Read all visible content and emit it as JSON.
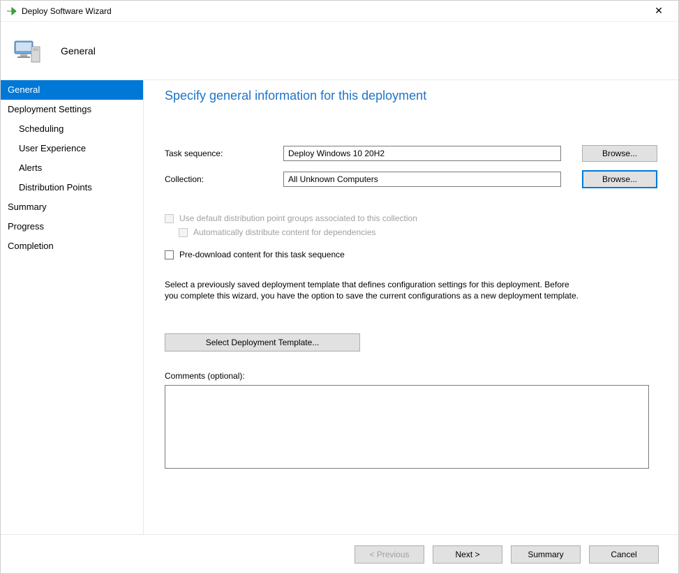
{
  "window": {
    "title": "Deploy Software Wizard",
    "close": "✕"
  },
  "header": {
    "page": "General"
  },
  "nav": {
    "items": [
      {
        "label": "General",
        "indent": 0,
        "selected": true
      },
      {
        "label": "Deployment Settings",
        "indent": 0,
        "selected": false
      },
      {
        "label": "Scheduling",
        "indent": 1,
        "selected": false
      },
      {
        "label": "User Experience",
        "indent": 1,
        "selected": false
      },
      {
        "label": "Alerts",
        "indent": 1,
        "selected": false
      },
      {
        "label": "Distribution Points",
        "indent": 1,
        "selected": false
      },
      {
        "label": "Summary",
        "indent": 0,
        "selected": false
      },
      {
        "label": "Progress",
        "indent": 0,
        "selected": false
      },
      {
        "label": "Completion",
        "indent": 0,
        "selected": false
      }
    ]
  },
  "main": {
    "heading": "Specify general information for this deployment",
    "task_label": "Task sequence:",
    "task_value": "Deploy Windows 10 20H2",
    "collection_label": "Collection:",
    "collection_value": "All Unknown Computers",
    "browse": "Browse...",
    "chk_default_dp": "Use default distribution point groups associated to this collection",
    "chk_auto_dist": "Automatically distribute content for dependencies",
    "chk_predownload": "Pre-download content for this task sequence",
    "template_info": "Select a previously saved deployment template that defines configuration settings for this deployment. Before you complete this wizard, you have the option to save the current configurations as a new deployment template.",
    "template_btn": "Select Deployment Template...",
    "comments_label": "Comments (optional):",
    "comments_value": ""
  },
  "footer": {
    "previous": "< Previous",
    "next": "Next >",
    "summary": "Summary",
    "cancel": "Cancel"
  }
}
